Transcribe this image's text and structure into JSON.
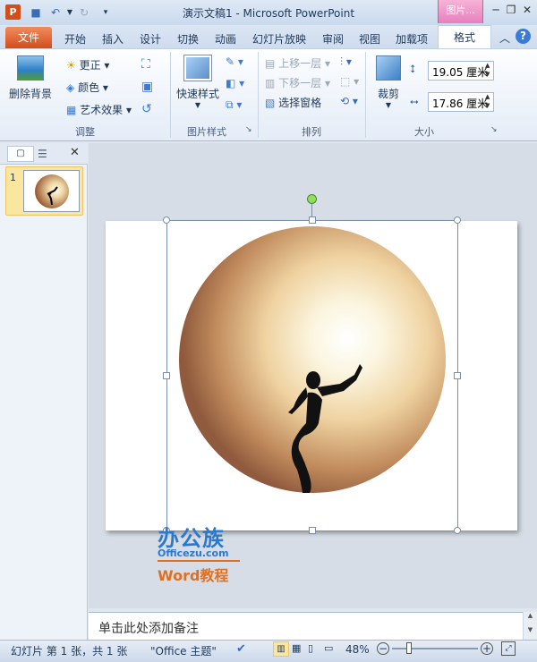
{
  "window": {
    "title": "演示文稿1 - Microsoft PowerPoint",
    "context_tab": "图片..."
  },
  "tabs": {
    "file": "文件",
    "items": [
      "开始",
      "插入",
      "设计",
      "切换",
      "动画",
      "幻灯片放映",
      "审阅",
      "视图",
      "加载项"
    ],
    "format": "格式"
  },
  "ribbon": {
    "adjust": {
      "remove_bg": "删除背景",
      "correct": "更正",
      "color": "颜色",
      "artistic": "艺术效果",
      "label": "调整"
    },
    "styles": {
      "quick": "快速样式",
      "label": "图片样式"
    },
    "arrange": {
      "forward": "上移一层",
      "backward": "下移一层",
      "selection": "选择窗格",
      "label": "排列"
    },
    "size": {
      "crop": "裁剪",
      "height": "19.05 厘米",
      "width": "17.86 厘米",
      "label": "大小"
    }
  },
  "thumbnail": {
    "number": "1"
  },
  "watermark": {
    "brand": "办公族",
    "site": "Officezu.com",
    "course": "Word教程"
  },
  "notes": {
    "placeholder": "单击此处添加备注"
  },
  "status": {
    "slide": "幻灯片 第 1 张，共 1 张",
    "theme": "\"Office 主题\"",
    "zoom": "48%"
  },
  "colors": {
    "accent": "#d24e1b",
    "watermark_blue": "#2a78d0",
    "watermark_orange": "#e07020",
    "context": "#e77fbd"
  }
}
